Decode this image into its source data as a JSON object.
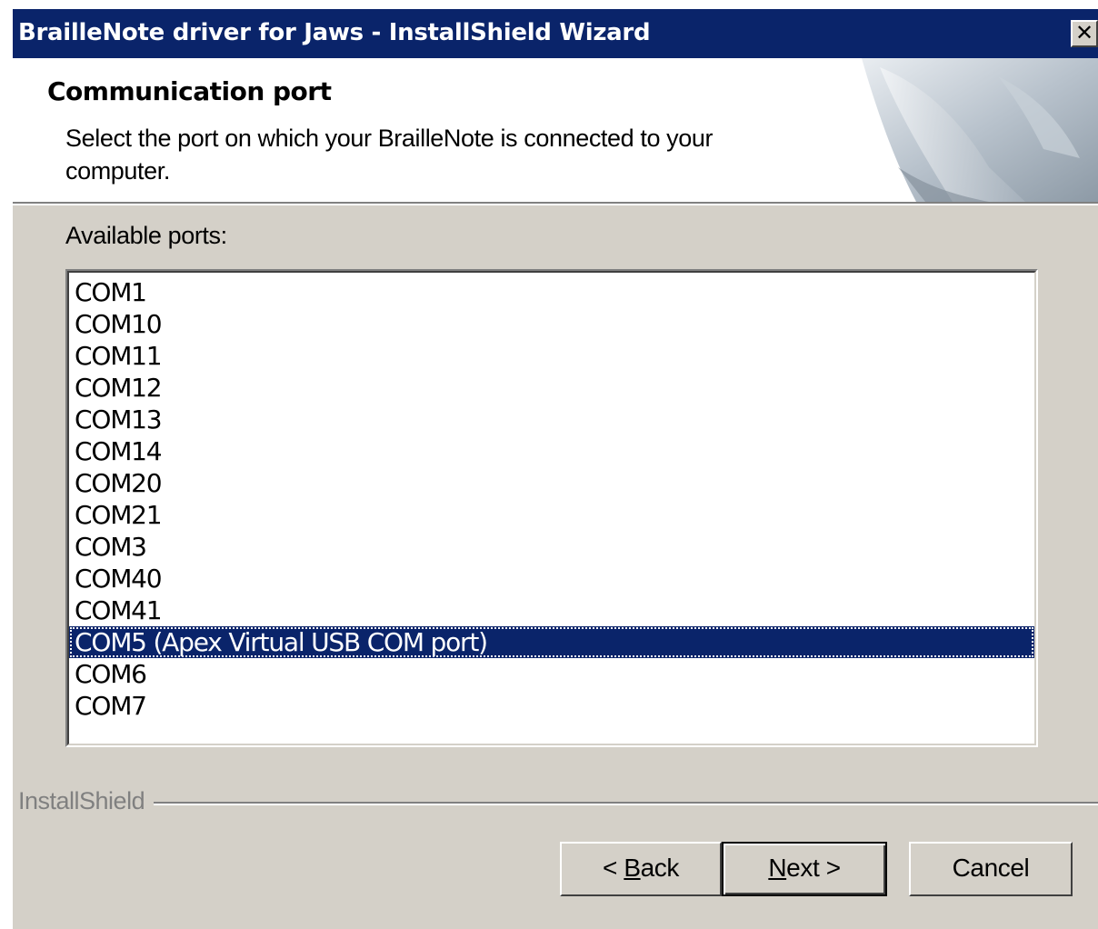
{
  "window": {
    "title": "BrailleNote driver for Jaws - InstallShield Wizard",
    "close_glyph": "✕"
  },
  "header": {
    "title": "Communication port",
    "description": "Select the port on which your BrailleNote is connected to your computer."
  },
  "ports": {
    "label": "Available ports:",
    "items": [
      "COM1",
      "COM10",
      "COM11",
      "COM12",
      "COM13",
      "COM14",
      "COM20",
      "COM21",
      "COM3",
      "COM40",
      "COM41",
      "COM5 (Apex Virtual USB COM port)",
      "COM6",
      "COM7"
    ],
    "selected_index": 11
  },
  "footer": {
    "brand": "InstallShield",
    "back_label": "< Back",
    "next_label": "Next >",
    "cancel_label": "Cancel"
  },
  "colors": {
    "titlebar": "#0a246a",
    "dialog_face": "#d4d0c8",
    "selection": "#0a246a"
  }
}
